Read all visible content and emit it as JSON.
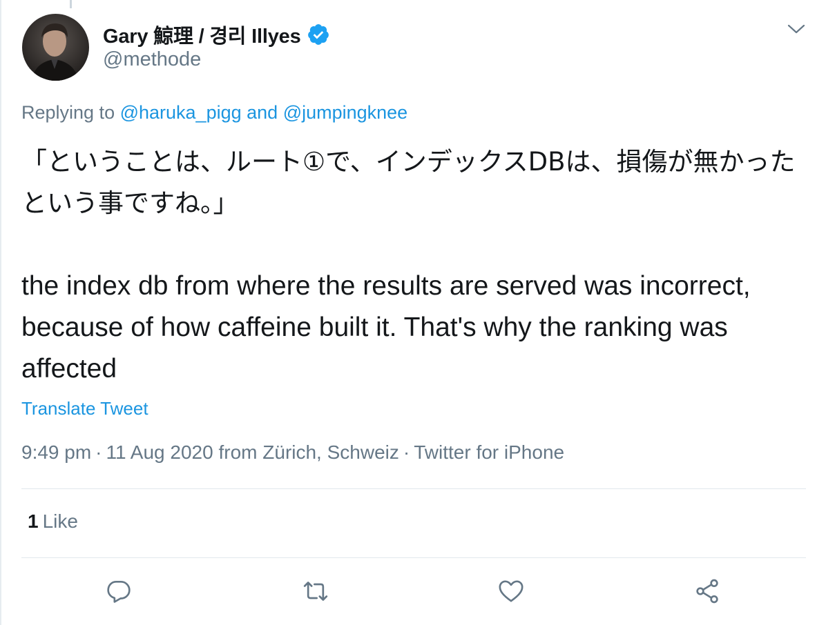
{
  "tweet": {
    "author": {
      "display_name": "Gary 鯨理 / 경리 Illyes",
      "handle": "@methode",
      "verified": true
    },
    "replying": {
      "prefix": "Replying to ",
      "user1": "@haruka_pigg",
      "conjunction": " and ",
      "user2": "@jumpingknee"
    },
    "text_jp": "「ということは、ルート①で、インデックスDBは、損傷が無かったという事ですね。」",
    "text_en": "the index db from where the results are served was incorrect, because of how caffeine built it. That's why the ranking was affected",
    "translate_label": "Translate Tweet",
    "meta": {
      "time": "9:49 pm",
      "date": "11 Aug 2020",
      "location": "from Zürich, Schweiz",
      "source": "Twitter for iPhone",
      "separator": "·"
    },
    "stats": {
      "likes_count": "1",
      "likes_label": "Like"
    }
  },
  "icons": {
    "verified": "verified-badge-icon",
    "caret": "chevron-down-icon",
    "reply": "reply-icon",
    "retweet": "retweet-icon",
    "like": "heart-icon",
    "share": "share-icon"
  },
  "colors": {
    "link": "#1b95e0",
    "verified": "#1da1f2",
    "secondary_text": "#657786",
    "primary_text": "#14171a",
    "divider": "#e1e8ed"
  }
}
